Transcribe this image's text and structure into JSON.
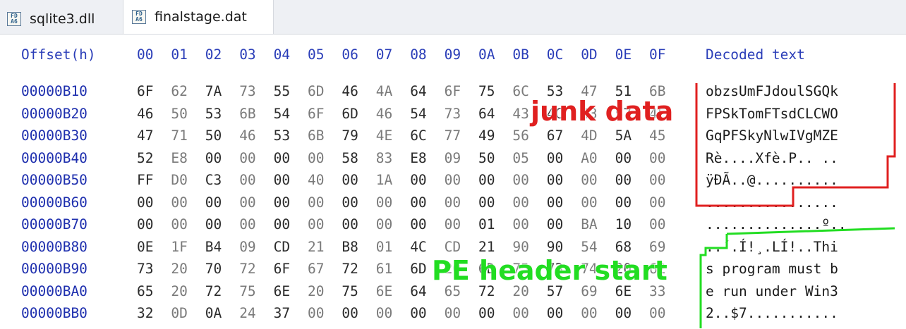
{
  "tabs": [
    {
      "label": "sqlite3.dll",
      "icon": "hex-file-icon",
      "active": false
    },
    {
      "label": "finalstage.dat",
      "icon": "hex-file-icon",
      "active": true
    }
  ],
  "hex_view": {
    "offset_header": "Offset(h)",
    "column_headers": [
      "00",
      "01",
      "02",
      "03",
      "04",
      "05",
      "06",
      "07",
      "08",
      "09",
      "0A",
      "0B",
      "0C",
      "0D",
      "0E",
      "0F"
    ],
    "decoded_header": "Decoded text",
    "rows": [
      {
        "offset": "00000B10",
        "bytes": [
          "6F",
          "62",
          "7A",
          "73",
          "55",
          "6D",
          "46",
          "4A",
          "64",
          "6F",
          "75",
          "6C",
          "53",
          "47",
          "51",
          "6B"
        ],
        "text": "obzsUmFJdoulSGQk"
      },
      {
        "offset": "00000B20",
        "bytes": [
          "46",
          "50",
          "53",
          "6B",
          "54",
          "6F",
          "6D",
          "46",
          "54",
          "73",
          "64",
          "43",
          "4C",
          "43",
          "57",
          "4F"
        ],
        "text": "FPSkTomFTsdCLCWO"
      },
      {
        "offset": "00000B30",
        "bytes": [
          "47",
          "71",
          "50",
          "46",
          "53",
          "6B",
          "79",
          "4E",
          "6C",
          "77",
          "49",
          "56",
          "67",
          "4D",
          "5A",
          "45"
        ],
        "text": "GqPFSkyNlwIVgMZE"
      },
      {
        "offset": "00000B40",
        "bytes": [
          "52",
          "E8",
          "00",
          "00",
          "00",
          "00",
          "58",
          "83",
          "E8",
          "09",
          "50",
          "05",
          "00",
          "A0",
          "00",
          "00"
        ],
        "text": "Rè....Xfè.P.. .."
      },
      {
        "offset": "00000B50",
        "bytes": [
          "FF",
          "D0",
          "C3",
          "00",
          "00",
          "40",
          "00",
          "1A",
          "00",
          "00",
          "00",
          "00",
          "00",
          "00",
          "00",
          "00"
        ],
        "text": "ÿÐÃ..@.........."
      },
      {
        "offset": "00000B60",
        "bytes": [
          "00",
          "00",
          "00",
          "00",
          "00",
          "00",
          "00",
          "00",
          "00",
          "00",
          "00",
          "00",
          "00",
          "00",
          "00",
          "00"
        ],
        "text": "................"
      },
      {
        "offset": "00000B70",
        "bytes": [
          "00",
          "00",
          "00",
          "00",
          "00",
          "00",
          "00",
          "00",
          "00",
          "00",
          "01",
          "00",
          "00",
          "BA",
          "10",
          "00"
        ],
        "text": "..............º.."
      },
      {
        "offset": "00000B80",
        "bytes": [
          "0E",
          "1F",
          "B4",
          "09",
          "CD",
          "21",
          "B8",
          "01",
          "4C",
          "CD",
          "21",
          "90",
          "90",
          "54",
          "68",
          "69"
        ],
        "text": "..´.Í!¸.LÍ!..Thi"
      },
      {
        "offset": "00000B90",
        "bytes": [
          "73",
          "20",
          "70",
          "72",
          "6F",
          "67",
          "72",
          "61",
          "6D",
          "20",
          "6D",
          "75",
          "73",
          "74",
          "20",
          "62"
        ],
        "text": "s program must b"
      },
      {
        "offset": "00000BA0",
        "bytes": [
          "65",
          "20",
          "72",
          "75",
          "6E",
          "20",
          "75",
          "6E",
          "64",
          "65",
          "72",
          "20",
          "57",
          "69",
          "6E",
          "33"
        ],
        "text": "e run under Win3"
      },
      {
        "offset": "00000BB0",
        "bytes": [
          "32",
          "0D",
          "0A",
          "24",
          "37",
          "00",
          "00",
          "00",
          "00",
          "00",
          "00",
          "00",
          "00",
          "00",
          "00",
          "00"
        ],
        "text": "2..$7..........."
      }
    ]
  },
  "annotations": {
    "junk_label": "junk data",
    "pe_label": "PE header start",
    "junk_color": "#e02020",
    "pe_color": "#22dd22"
  }
}
